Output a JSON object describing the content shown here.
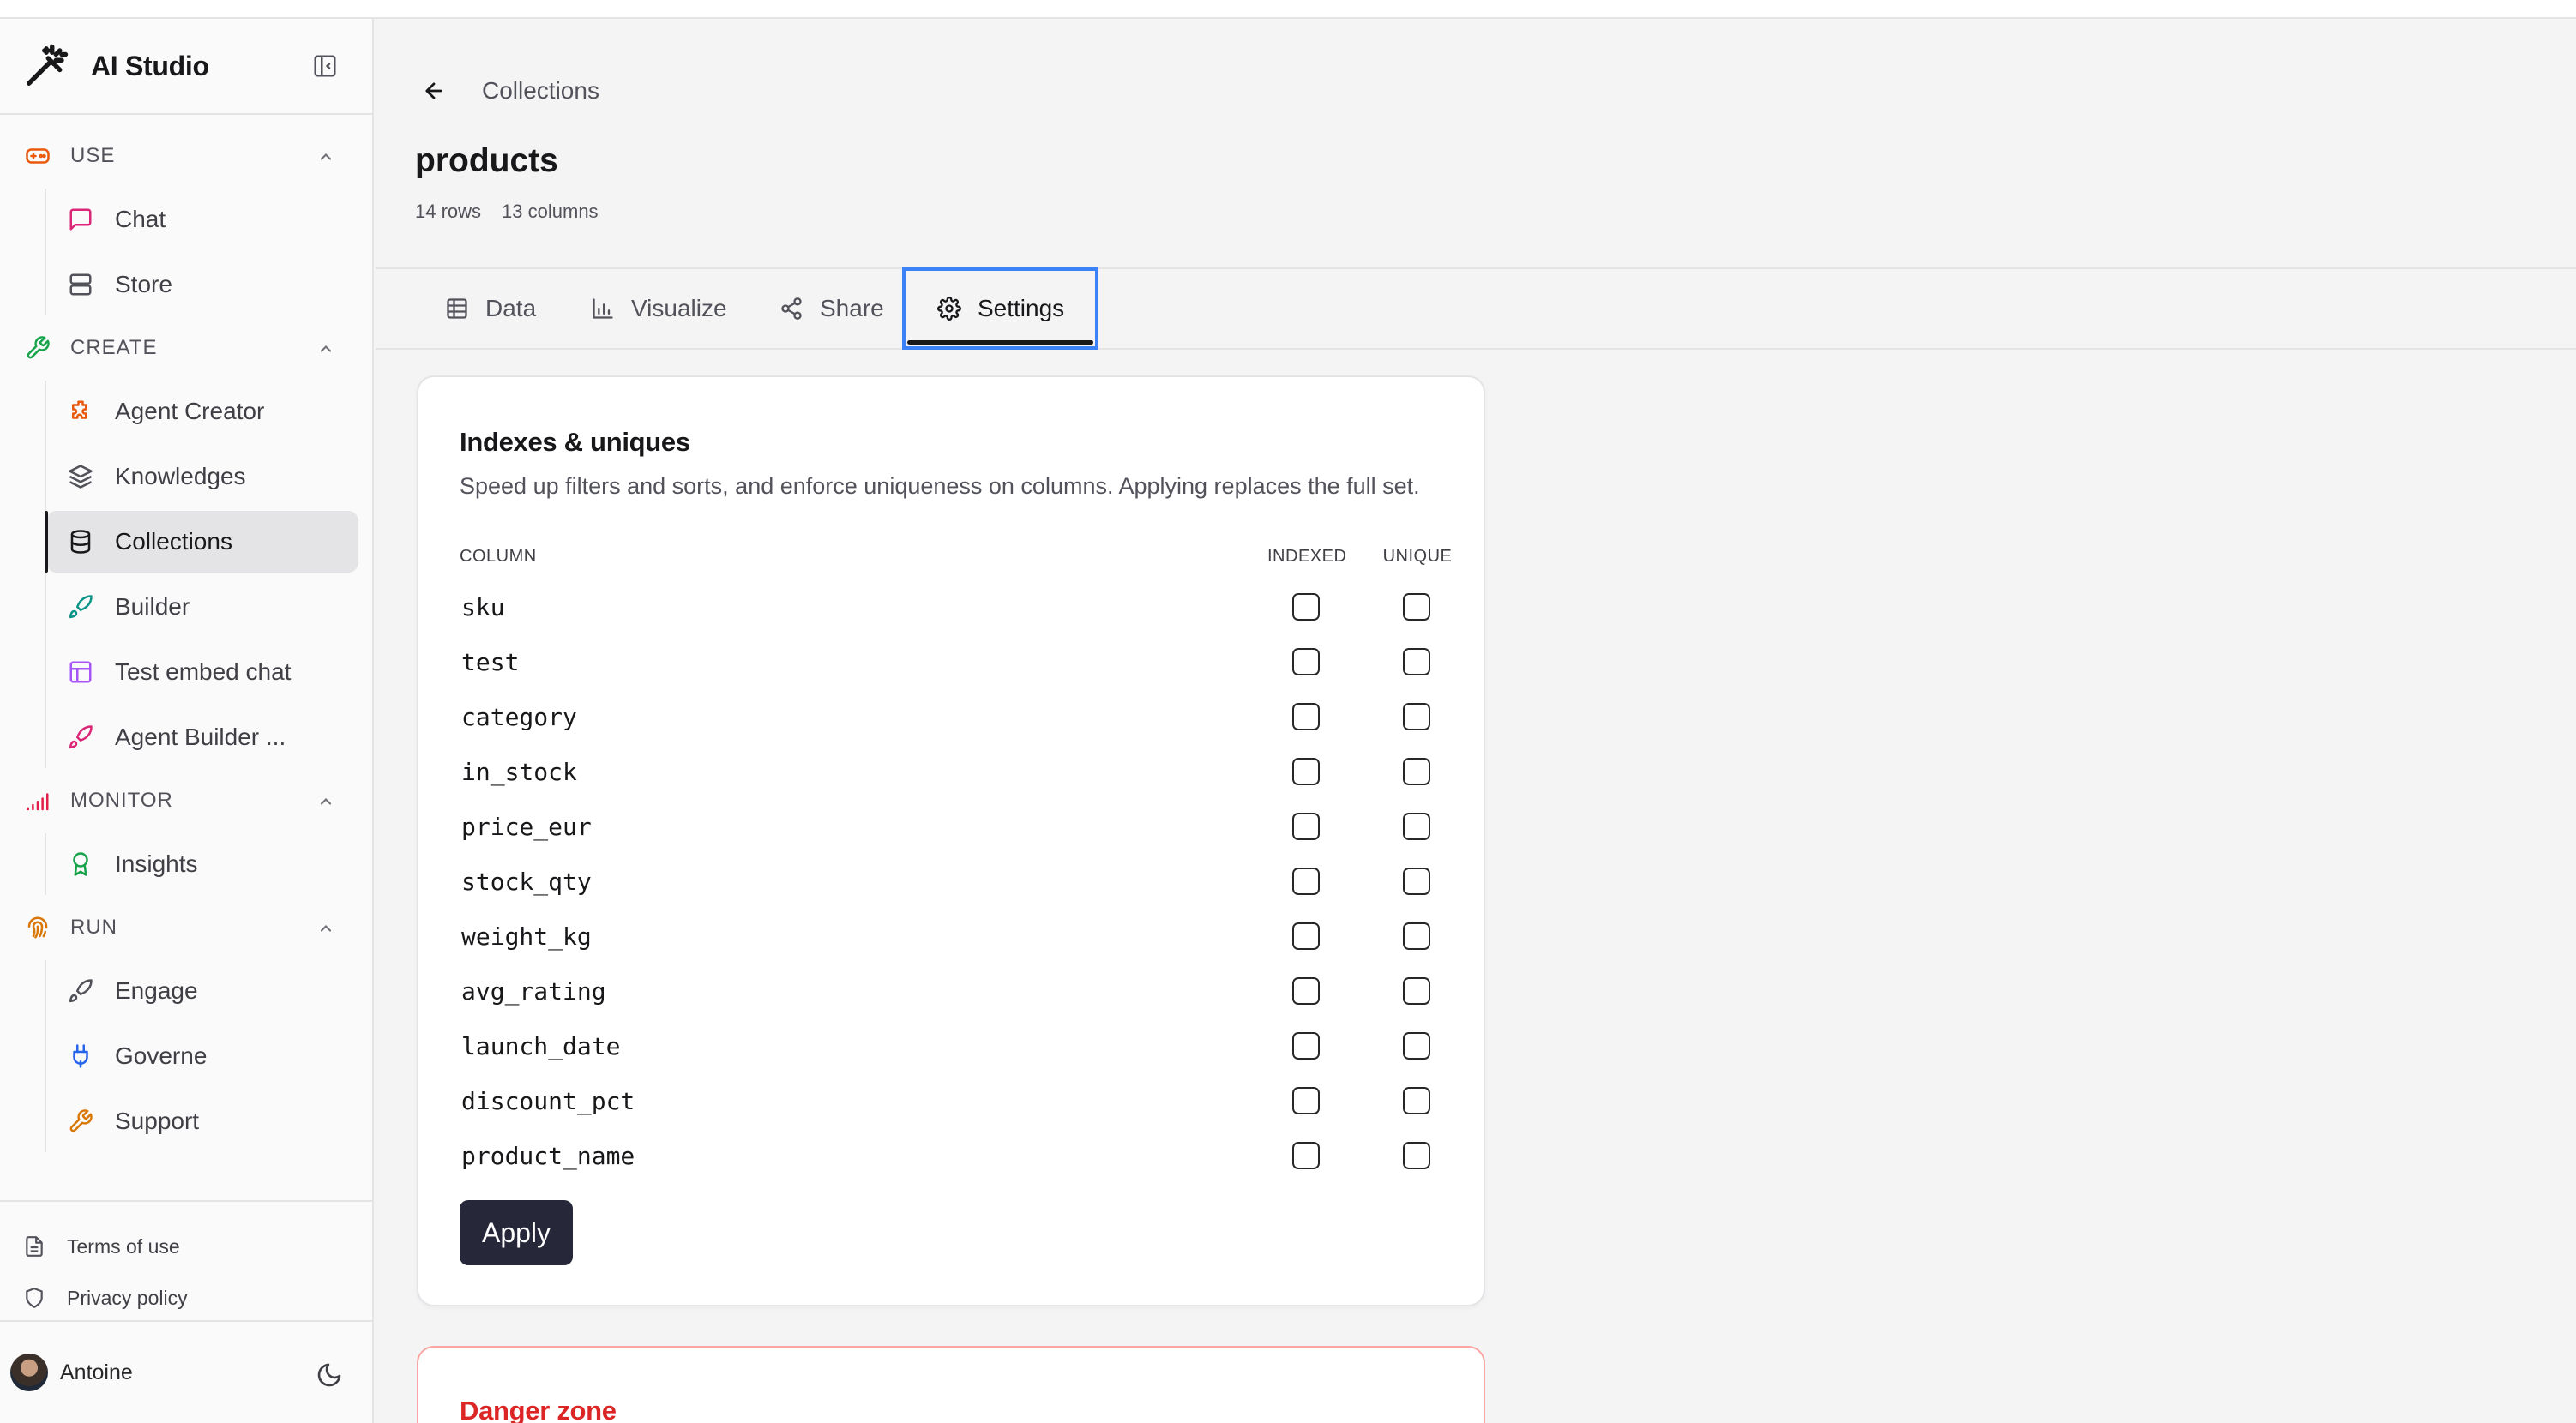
{
  "app": {
    "title": "AI Studio"
  },
  "sidebar": {
    "sections": [
      {
        "label": "USE",
        "items": [
          {
            "label": "Chat"
          },
          {
            "label": "Store"
          }
        ]
      },
      {
        "label": "CREATE",
        "items": [
          {
            "label": "Agent Creator"
          },
          {
            "label": "Knowledges"
          },
          {
            "label": "Collections"
          },
          {
            "label": "Builder"
          },
          {
            "label": "Test embed chat"
          },
          {
            "label": "Agent Builder ..."
          }
        ]
      },
      {
        "label": "MONITOR",
        "items": [
          {
            "label": "Insights"
          }
        ]
      },
      {
        "label": "RUN",
        "items": [
          {
            "label": "Engage"
          },
          {
            "label": "Governe"
          },
          {
            "label": "Support"
          }
        ]
      }
    ],
    "active_item": "Collections",
    "footer": {
      "terms": "Terms of use",
      "privacy": "Privacy policy"
    },
    "user": {
      "name": "Antoine"
    }
  },
  "breadcrumb": {
    "label": "Collections"
  },
  "page": {
    "title": "products",
    "rows": "14 rows",
    "columns": "13 columns"
  },
  "tabs": [
    {
      "label": "Data"
    },
    {
      "label": "Visualize"
    },
    {
      "label": "Share"
    },
    {
      "label": "Settings"
    }
  ],
  "active_tab": "Settings",
  "indexes": {
    "title": "Indexes & uniques",
    "description": "Speed up filters and sorts, and enforce uniqueness on columns. Applying replaces the full set.",
    "headers": {
      "column": "COLUMN",
      "indexed": "INDEXED",
      "unique": "UNIQUE"
    },
    "rows": [
      {
        "name": "sku",
        "indexed": false,
        "unique": false
      },
      {
        "name": "test",
        "indexed": false,
        "unique": false
      },
      {
        "name": "category",
        "indexed": false,
        "unique": false
      },
      {
        "name": "in_stock",
        "indexed": false,
        "unique": false
      },
      {
        "name": "price_eur",
        "indexed": false,
        "unique": false
      },
      {
        "name": "stock_qty",
        "indexed": false,
        "unique": false
      },
      {
        "name": "weight_kg",
        "indexed": false,
        "unique": false
      },
      {
        "name": "avg_rating",
        "indexed": false,
        "unique": false
      },
      {
        "name": "launch_date",
        "indexed": false,
        "unique": false
      },
      {
        "name": "discount_pct",
        "indexed": false,
        "unique": false
      },
      {
        "name": "product_name",
        "indexed": false,
        "unique": false
      }
    ],
    "apply_label": "Apply"
  },
  "danger": {
    "title": "Danger zone"
  },
  "colors": {
    "accent_focus": "#3b82f6",
    "primary_button": "#27273a",
    "danger": "#dc2626",
    "use": "#ea580c",
    "create": "#16a34a",
    "monitor": "#e11d48",
    "run": "#d97706"
  },
  "icons": {
    "brand": "magic-wand-icon",
    "collapse": "sidebar-collapse-icon",
    "use": "gamepad-icon",
    "create": "wrench-icon",
    "monitor": "signal-bars-icon",
    "run": "fingerprint-icon",
    "chat": "message-square-icon",
    "store": "server-icon",
    "agent_creator": "puzzle-icon",
    "knowledges": "layers-icon",
    "collections": "database-icon",
    "builder": "rocket-icon",
    "test_embed_chat": "layout-icon",
    "agent_builder": "rocket-icon",
    "insights": "award-icon",
    "engage": "rocket-icon",
    "governe": "plug-icon",
    "support": "wrench-icon",
    "terms": "file-text-icon",
    "privacy": "shield-icon",
    "theme": "moon-icon",
    "back": "arrow-left-icon",
    "data": "table-icon",
    "visualize": "bar-chart-icon",
    "share": "share-icon",
    "settings": "gear-icon"
  }
}
